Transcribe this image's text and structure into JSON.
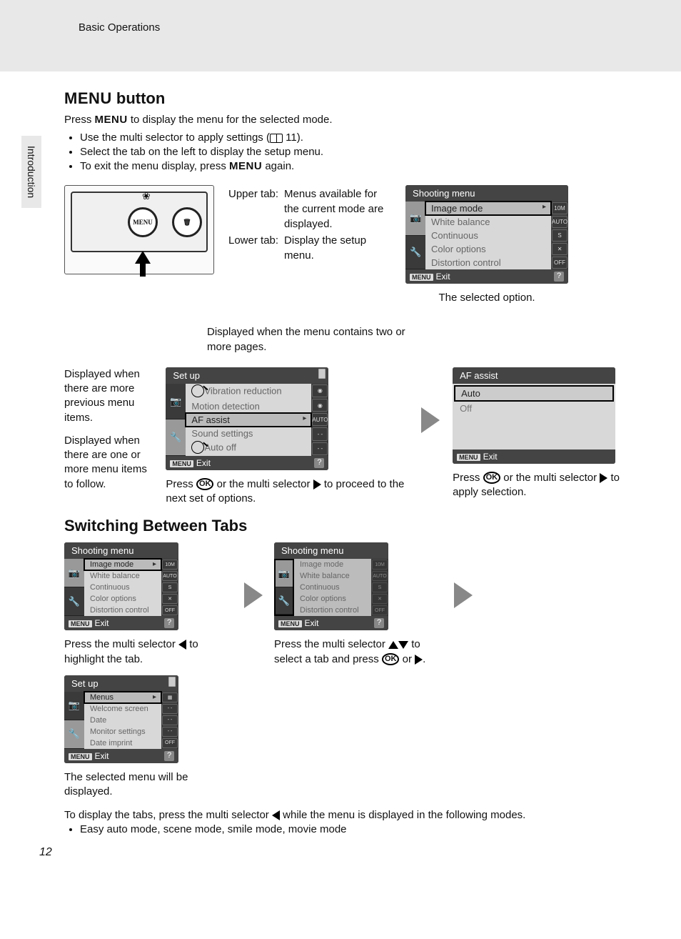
{
  "header": {
    "section": "Basic Operations"
  },
  "side_tab": "Introduction",
  "page_number": "12",
  "menu_button": {
    "heading_prefix": "MENU",
    "heading_suffix": " button",
    "intro_pre": "Press ",
    "intro_menu": "MENU",
    "intro_post": " to display the menu for the selected mode.",
    "bullets": {
      "b1_pre": "Use the multi selector to apply settings (",
      "b1_ref": "11",
      "b1_post": ").",
      "b2": "Select the tab on the left to display the setup menu.",
      "b3_pre": "To exit the menu display, press ",
      "b3_menu": "MENU",
      "b3_post": " again."
    },
    "cam_menu_label": "MENU",
    "tab_labels": {
      "upper_label": "Upper tab:",
      "upper_desc": "Menus available for the current mode are displayed.",
      "lower_label": "Lower tab:",
      "lower_desc": "Display the setup menu."
    },
    "selected_caption": "The selected option."
  },
  "lcd_shooting": {
    "title": "Shooting menu",
    "items": [
      "Image mode",
      "White balance",
      "Continuous",
      "Color options",
      "Distortion control"
    ],
    "icons": [
      "10M",
      "AUTO",
      "S",
      "✕",
      "OFF"
    ],
    "exit": "Exit",
    "menu_badge": "MENU",
    "help": "?"
  },
  "middle": {
    "scroll_caption": "Displayed when the menu contains two or more pages.",
    "prev_caption": "Displayed when there are more previous menu items.",
    "next_caption": "Displayed when there are one or more menu items to follow.",
    "setup_title": "Set up",
    "setup_items": [
      "Vibration reduction",
      "Motion detection",
      "AF assist",
      "Sound settings",
      "Auto off"
    ],
    "setup_icons": [
      "◉",
      "◉",
      "AUTO",
      "- -",
      "- -"
    ],
    "proceed_pre": "Press ",
    "proceed_ok": "OK",
    "proceed_mid": " or the multi selector ",
    "proceed_post": " to proceed to the next set of options.",
    "af_title": "AF assist",
    "af_options": [
      "Auto",
      "Off"
    ],
    "apply_pre": "Press ",
    "apply_ok": "OK",
    "apply_mid": " or the multi selector ",
    "apply_post": " to apply selection."
  },
  "tabs": {
    "heading": "Switching Between Tabs",
    "cap1_pre": "Press the multi selector ",
    "cap1_post": " to highlight the tab.",
    "cap2_pre": "Press the multi selector ",
    "cap2_mid": " to select a tab and press ",
    "cap2_ok": "OK",
    "cap2_post": " or ",
    "cap2_end": ".",
    "cap3": "The selected menu will be displayed.",
    "setup_title": "Set up",
    "setup_items": [
      "Menus",
      "Welcome screen",
      "Date",
      "Monitor settings",
      "Date imprint"
    ],
    "setup_icons": [
      "▦",
      "- -",
      "- -",
      "- -",
      "OFF"
    ],
    "closing_pre": "To display the tabs, press the multi selector ",
    "closing_post": " while the menu is displayed in the following modes.",
    "modes": "Easy auto mode, scene mode, smile mode, movie mode"
  }
}
